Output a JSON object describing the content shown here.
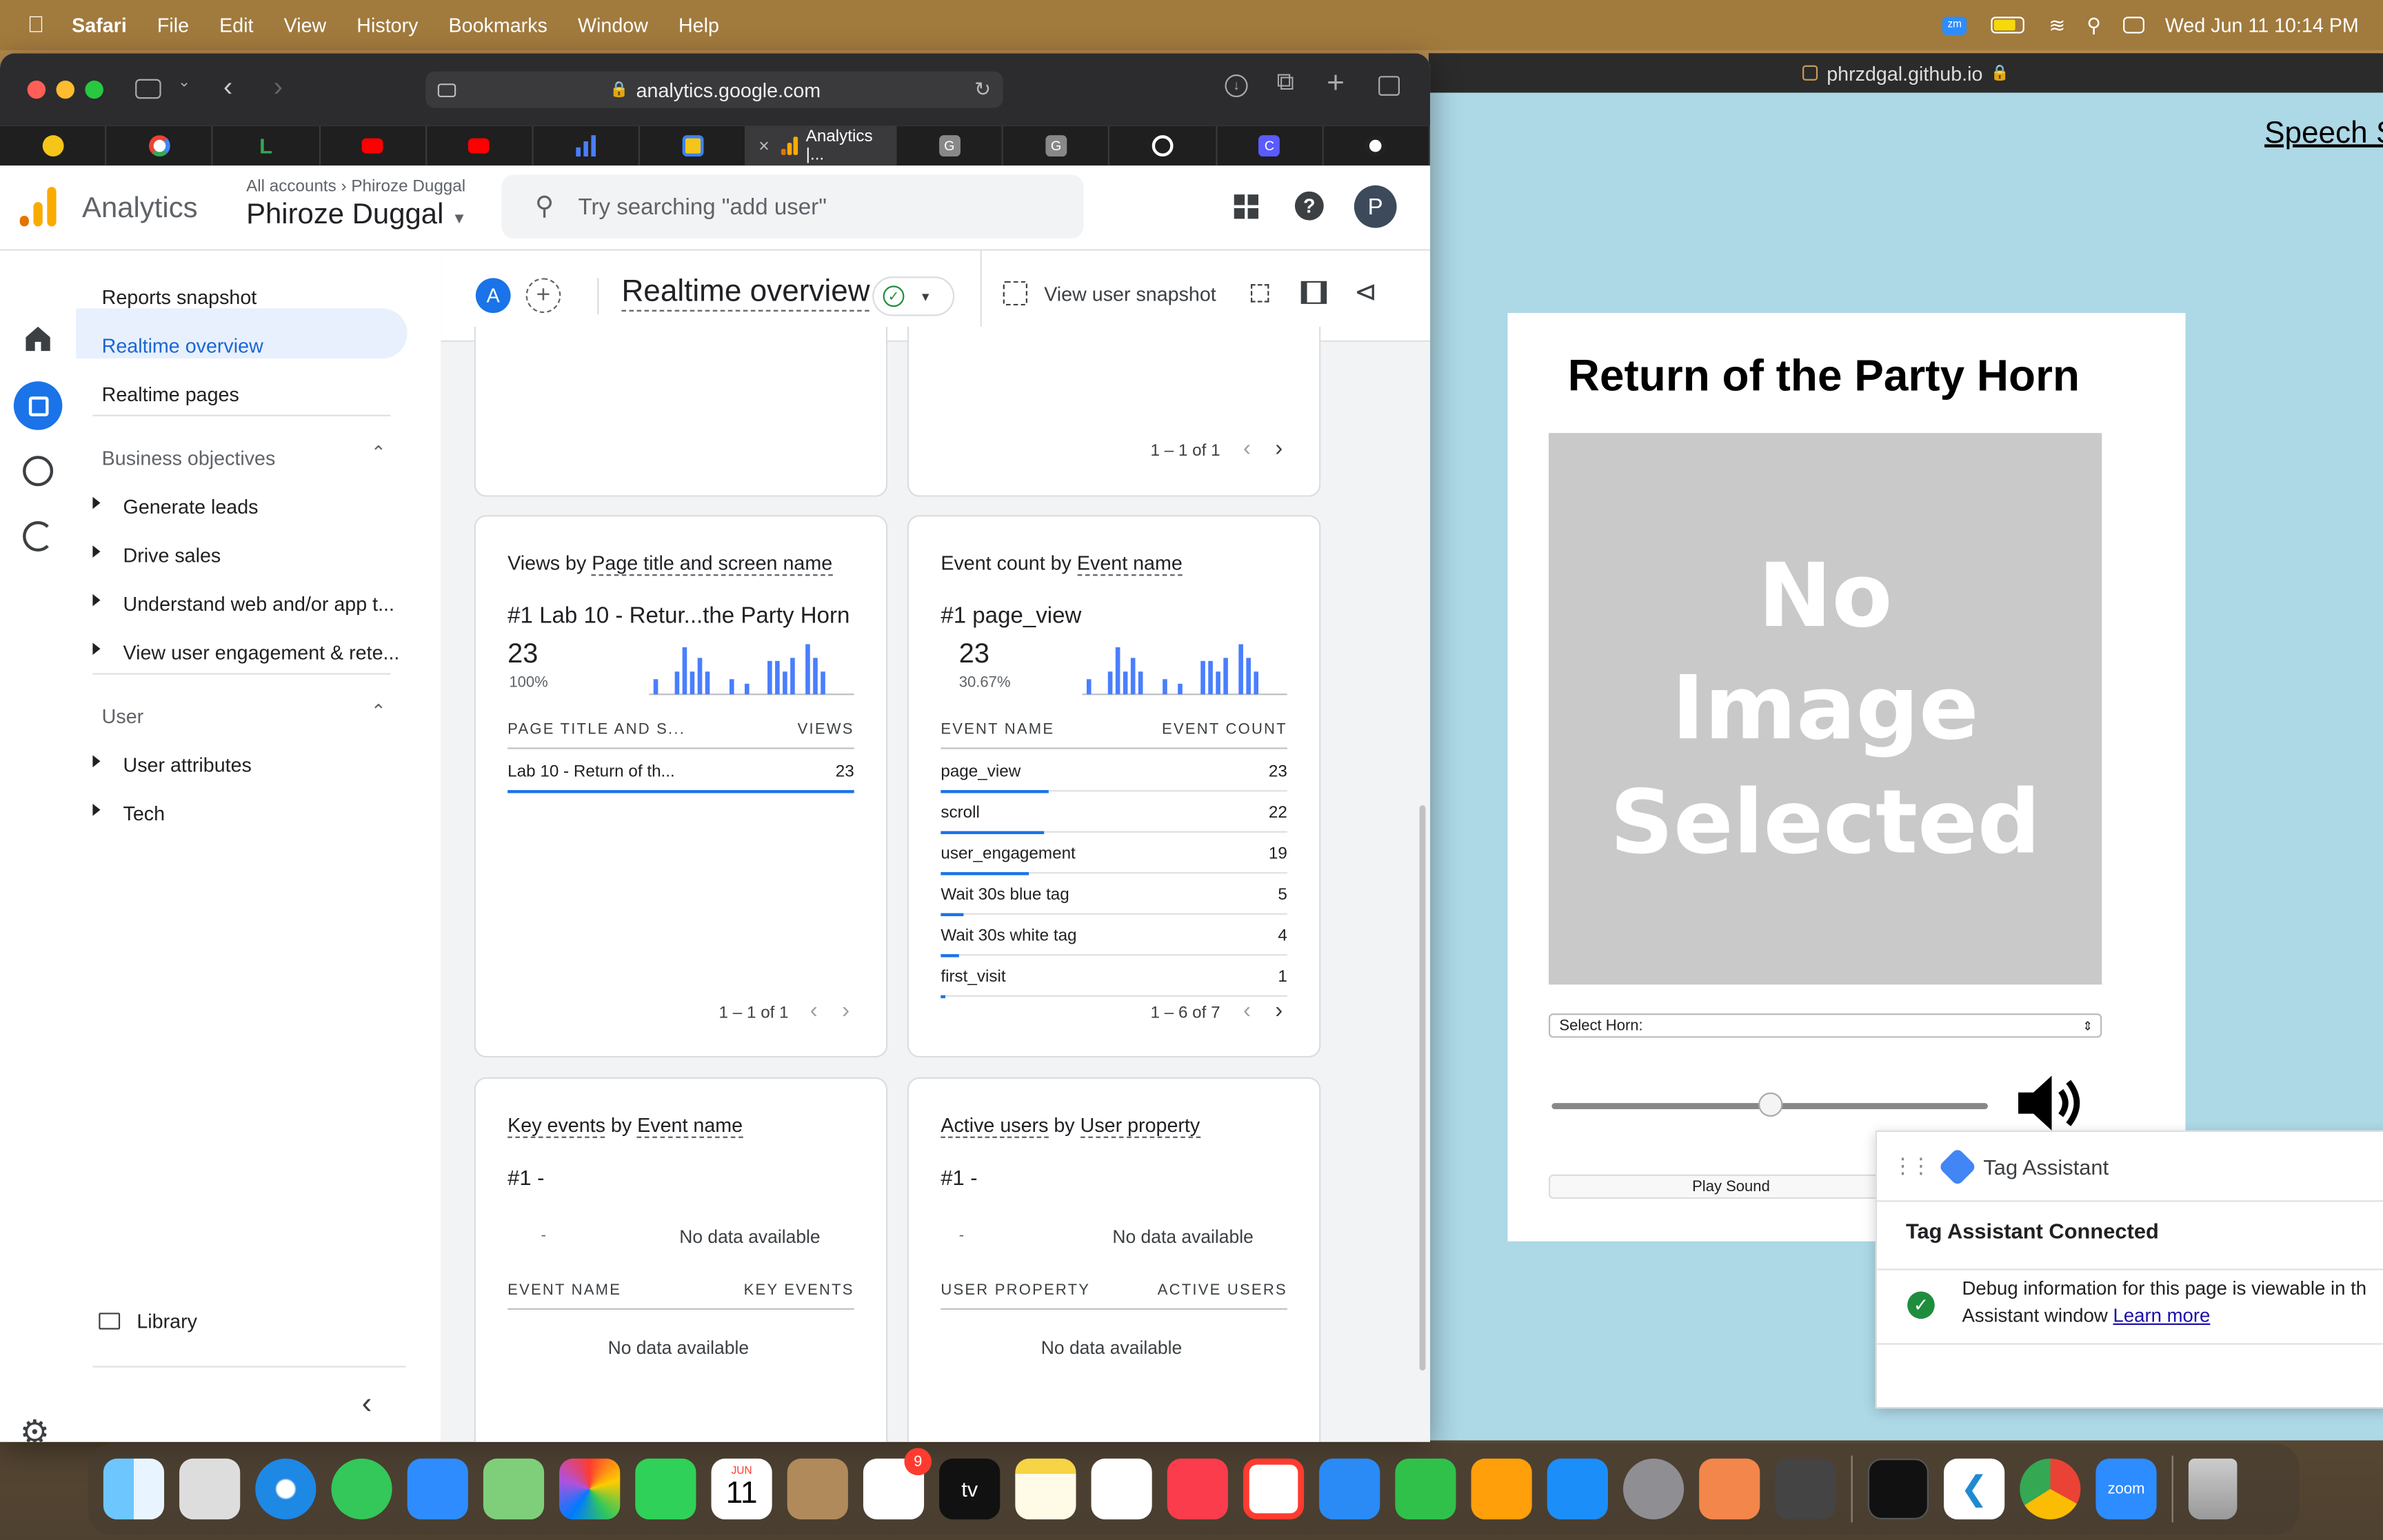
{
  "menubar": {
    "app": "Safari",
    "menus": [
      "File",
      "Edit",
      "View",
      "History",
      "Bookmarks",
      "Window",
      "Help"
    ],
    "datetime": "Wed Jun 11  10:14 PM"
  },
  "safari": {
    "url": "analytics.google.com",
    "active_tab_label": "Analytics |...",
    "tab_icons": [
      "bee-favicon",
      "google-favicon",
      "l-favicon",
      "youtube-favicon",
      "youtube-favicon",
      "analytics-bars-favicon",
      "pencil-favicon",
      "analytics-favicon",
      "g-favicon",
      "g-favicon",
      "openai-favicon",
      "c-favicon",
      "github-favicon"
    ]
  },
  "ga": {
    "product": "Analytics",
    "breadcrumb_all": "All accounts",
    "breadcrumb_account": "Phiroze Duggal",
    "property": "Phiroze Duggal",
    "search_placeholder": "Try searching \"add user\"",
    "avatar_letter": "P",
    "page_title": "Realtime overview",
    "compare_letter": "A",
    "view_snapshot": "View user snapshot"
  },
  "nav": {
    "reports_snapshot": "Reports snapshot",
    "realtime_overview": "Realtime overview",
    "realtime_pages": "Realtime pages",
    "business_objectives": "Business objectives",
    "generate_leads": "Generate leads",
    "drive_sales": "Drive sales",
    "understand": "Understand web and/or app t...",
    "view_engagement": "View user engagement & rete...",
    "user": "User",
    "user_attributes": "User attributes",
    "tech": "Tech",
    "library": "Library"
  },
  "cards": {
    "top_pager": "1 – 1 of 1",
    "views": {
      "title_a": "Views by ",
      "title_b": "Page title and screen name",
      "rank_label": "#1  Lab 10 - Retur...the Party Horn",
      "big": "23",
      "pct": "100%",
      "col1": "PAGE TITLE AND S...",
      "col2": "VIEWS",
      "row_name": "Lab 10 - Return of th...",
      "row_val": "23",
      "pager": "1 – 1 of 1"
    },
    "events": {
      "title_a": "Event count by ",
      "title_b": "Event name",
      "rank_label": "#1  page_view",
      "big": "23",
      "pct": "30.67%",
      "col1": "EVENT NAME",
      "col2": "EVENT COUNT",
      "rows": [
        {
          "name": "page_view",
          "value": "23"
        },
        {
          "name": "scroll",
          "value": "22"
        },
        {
          "name": "user_engagement",
          "value": "19"
        },
        {
          "name": "Wait 30s blue tag",
          "value": "5"
        },
        {
          "name": "Wait 30s white tag",
          "value": "4"
        },
        {
          "name": "first_visit",
          "value": "1"
        }
      ],
      "pager": "1 – 6 of 7"
    },
    "key_events": {
      "title_a": "Key events",
      "title_mid": " by ",
      "title_b": "Event name",
      "rank": "#1  -",
      "dash": "-",
      "nodata_top": "No data available",
      "col1": "EVENT NAME",
      "col2": "KEY EVENTS",
      "nodata": "No data available"
    },
    "active_users": {
      "title_a": "Active users",
      "title_mid": " by ",
      "title_b": "User property",
      "rank": "#1  -",
      "dash": "-",
      "nodata_top": "No data available",
      "col1": "USER PROPERTY",
      "col2": "ACTIVE USERS",
      "nodata": "No data available"
    }
  },
  "right_page": {
    "title_bar": "phrzdgal.github.io",
    "speech_link": "Speech S",
    "heading": "Return of the Party Horn",
    "no_image": "No Image Selected",
    "select_label": "Select Horn:",
    "play": "Play Sound",
    "volume_level": 0.5
  },
  "tag_assistant": {
    "title": "Tag Assistant",
    "connected": "Tag Assistant Connected",
    "debug_line1": "Debug information for this page is viewable in th",
    "debug_line2": "Assistant window ",
    "learn_more": "Learn more"
  },
  "dock": {
    "calendar_month": "JUN",
    "calendar_day": "11",
    "reminders_badge": "9",
    "tv_label": "tv",
    "zoom_label": "zoom"
  },
  "colors": {
    "ga_blue": "#1a73e8",
    "ga_orange": "#f9ab00",
    "ga_dark_orange": "#e37400"
  }
}
